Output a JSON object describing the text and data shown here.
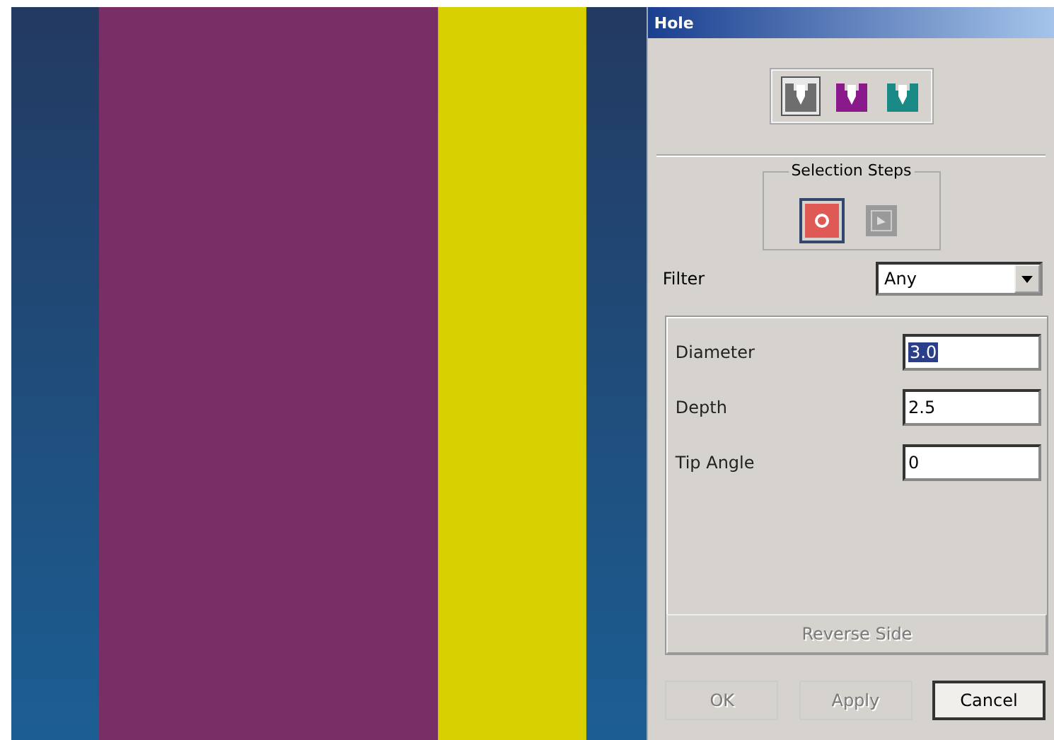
{
  "window": {
    "title": "Hole"
  },
  "hole_types": [
    {
      "color": "#6e6e6e",
      "selected": true
    },
    {
      "color": "#8a1a8c",
      "selected": false
    },
    {
      "color": "#1a8a86",
      "selected": false
    }
  ],
  "selection_steps": {
    "title": "Selection Steps",
    "steps": [
      {
        "kind": "face",
        "selected": true
      },
      {
        "kind": "point",
        "selected": false
      }
    ]
  },
  "filter": {
    "label": "Filter",
    "value": "Any"
  },
  "parameters": [
    {
      "label": "Diameter",
      "value": "3.0",
      "highlighted": true
    },
    {
      "label": "Depth",
      "value": "2.5",
      "highlighted": false
    },
    {
      "label": "Tip Angle",
      "value": "0",
      "highlighted": false
    }
  ],
  "reverse_side": {
    "label": "Reverse Side",
    "disabled": true
  },
  "buttons": [
    {
      "label": "OK",
      "disabled": true
    },
    {
      "label": "Apply",
      "disabled": true
    },
    {
      "label": "Cancel",
      "disabled": false
    }
  ]
}
